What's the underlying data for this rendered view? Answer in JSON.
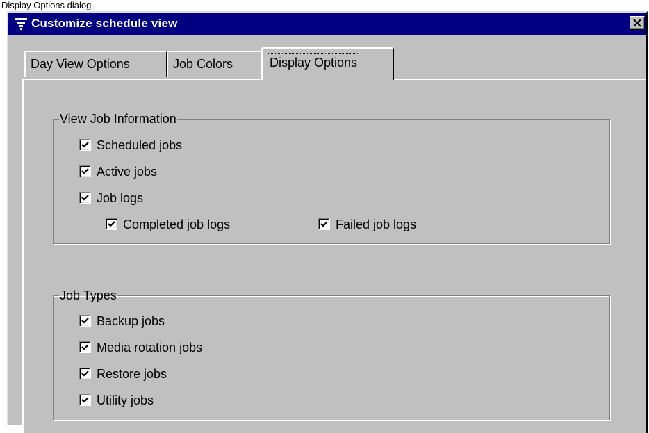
{
  "screen_caption": "Display Options dialog",
  "window": {
    "title": "Customize schedule view",
    "close_glyph": "✕"
  },
  "tabs": [
    {
      "label": "Day View Options",
      "active": false
    },
    {
      "label": "Job Colors",
      "active": false
    },
    {
      "label": "Display Options",
      "active": true
    }
  ],
  "groups": {
    "view_job_information": {
      "title": "View Job Information",
      "items": [
        {
          "label": "Scheduled jobs",
          "checked": true
        },
        {
          "label": "Active jobs",
          "checked": true
        },
        {
          "label": "Job logs",
          "checked": true
        },
        {
          "label": "Completed job logs",
          "checked": true
        },
        {
          "label": "Failed job logs",
          "checked": true
        }
      ]
    },
    "job_types": {
      "title": "Job Types",
      "items": [
        {
          "label": "Backup jobs",
          "checked": true
        },
        {
          "label": "Media rotation jobs",
          "checked": true
        },
        {
          "label": "Restore jobs",
          "checked": true
        },
        {
          "label": "Utility jobs",
          "checked": true
        }
      ]
    }
  },
  "colors": {
    "titlebar": "#000080",
    "face": "#c0c0c0"
  }
}
